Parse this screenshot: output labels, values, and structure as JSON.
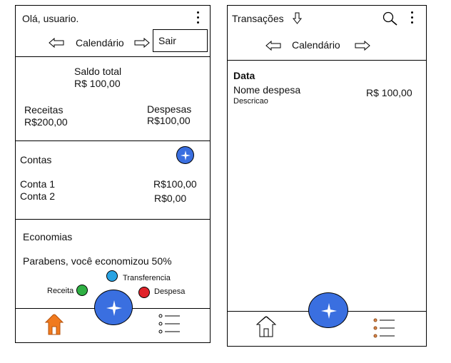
{
  "screen_home": {
    "greeting": "Olá, usuario.",
    "calendar_label": "Calendário",
    "logout_label": "Sair",
    "balance": {
      "title": "Saldo total",
      "value": "R$ 100,00",
      "income_label": "Receitas",
      "income_value": "R$200,00",
      "expense_label": "Despesas",
      "expense_value": "R$100,00"
    },
    "accounts": {
      "title": "Contas",
      "items": [
        {
          "name": "Conta 1",
          "value": "R$100,00"
        },
        {
          "name": "Conta 2",
          "value": "R$0,00"
        }
      ]
    },
    "savings": {
      "title": "Economias",
      "message": "Parabens, você economizou 50%"
    },
    "fab_menu": {
      "transfer_label": "Transferencia",
      "income_label": "Receita",
      "expense_label": "Despesa"
    },
    "colors": {
      "fab": "#3a6fe0",
      "transfer": "#29a3e3",
      "income": "#2fb043",
      "expense": "#e0232a",
      "home_active": "#f07a1e"
    }
  },
  "screen_transactions": {
    "title": "Transações",
    "calendar_label": "Calendário",
    "group_label": "Data",
    "item": {
      "name": "Nome despesa",
      "description": "Descricao",
      "value": "R$ 100,00"
    }
  },
  "icons": {
    "menu": "kebab-menu-icon",
    "prev": "arrow-left-icon",
    "next": "arrow-right-icon",
    "add": "sparkle-plus-icon",
    "search": "search-icon",
    "sort": "arrow-down-icon",
    "home": "home-icon",
    "list": "list-icon"
  }
}
